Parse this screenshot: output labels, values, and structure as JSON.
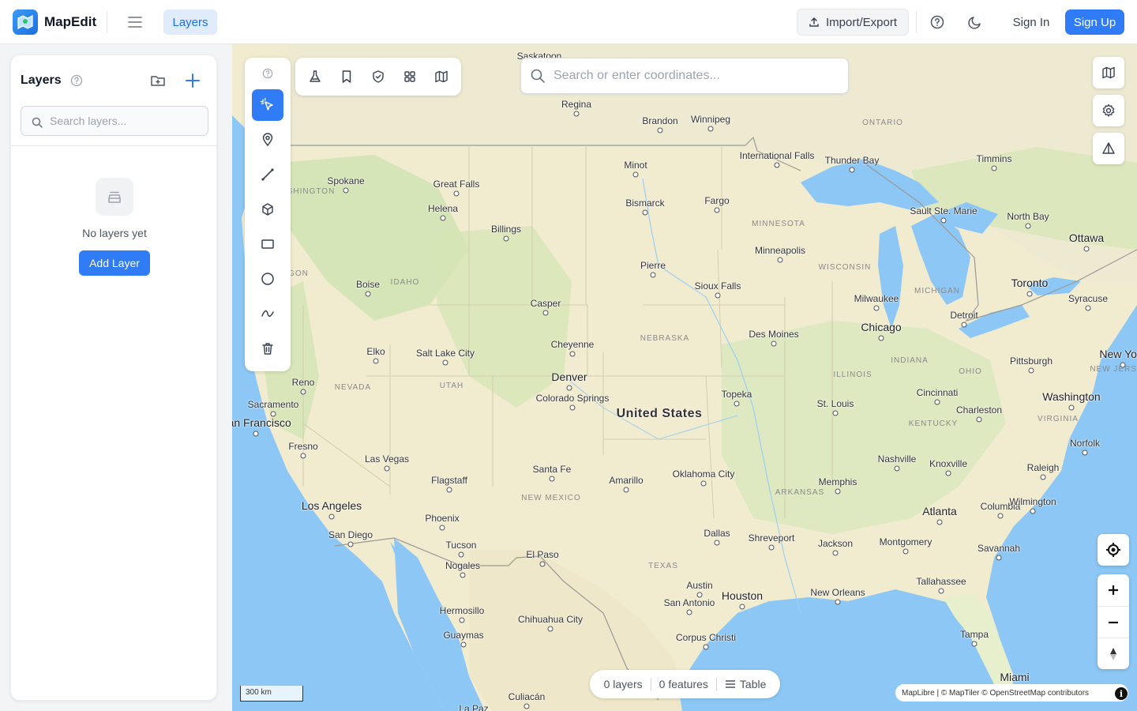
{
  "app": {
    "name": "MapEdit"
  },
  "topbar": {
    "tab_layers": "Layers",
    "import_export": "Import/Export",
    "sign_in": "Sign In",
    "sign_up": "Sign Up",
    "accent": "#2f7cf6"
  },
  "sidebar": {
    "title": "Layers",
    "search_placeholder": "Search layers...",
    "empty_text": "No layers yet",
    "add_layer": "Add Layer"
  },
  "map": {
    "search_placeholder": "Search or enter coordinates...",
    "scale": "300 km",
    "status": {
      "layers": "0 layers",
      "features": "0 features",
      "table": "Table"
    },
    "attribution": "MapLibre | © MapTiler © OpenStreetMap contributors",
    "country_label": "United States",
    "cities": [
      "Saskatoon",
      "Regina",
      "Brandon",
      "Winnipeg",
      "Minot",
      "International Falls",
      "Thunder Bay",
      "Timmins",
      "Spokane",
      "Great Falls",
      "Helena",
      "Bismarck",
      "Fargo",
      "Sault Ste. Marie",
      "North Bay",
      "Ottawa",
      "Billings",
      "Minneapolis",
      "Pierre",
      "Boise",
      "Casper",
      "Sioux Falls",
      "Milwaukee",
      "Toronto",
      "Syracuse",
      "Detroit",
      "Chicago",
      "Des Moines",
      "Salt Lake City",
      "Cheyenne",
      "Elko",
      "Reno",
      "Denver",
      "Pittsburgh",
      "New York",
      "Colorado Springs",
      "Topeka",
      "Sacramento",
      "San Francisco",
      "St. Louis",
      "Cincinnati",
      "Washington",
      "Charleston",
      "Fresno",
      "Las Vegas",
      "Santa Fe",
      "Amarillo",
      "Oklahoma City",
      "Nashville",
      "Knoxville",
      "Norfolk",
      "Raleigh",
      "Flagstaff",
      "Memphis",
      "Los Angeles",
      "Phoenix",
      "Atlanta",
      "Columbia",
      "Wilmington",
      "San Diego",
      "Dallas",
      "Shreveport",
      "Jackson",
      "Montgomery",
      "Tucson",
      "El Paso",
      "Nogales",
      "Savannah",
      "Austin",
      "Houston",
      "San Antonio",
      "New Orleans",
      "Tallahassee",
      "Hermosillo",
      "Chihuahua City",
      "Guaymas",
      "Corpus Christi",
      "Tampa",
      "Culiacán",
      "La Paz",
      "Miami"
    ],
    "regions": [
      "ONTARIO",
      "SHINGTON",
      "MINNESOTA",
      "GON",
      "IDAHO",
      "WISCONSIN",
      "MICHIGAN",
      "NEBRASKA",
      "INDIANA",
      "OHIO",
      "NEW JERSE",
      "NEVADA",
      "UTAH",
      "ILLINOIS",
      "KENTUCKY",
      "VIRGINIA",
      "NEW MEXICO",
      "ARKANSAS",
      "TEXAS"
    ]
  }
}
